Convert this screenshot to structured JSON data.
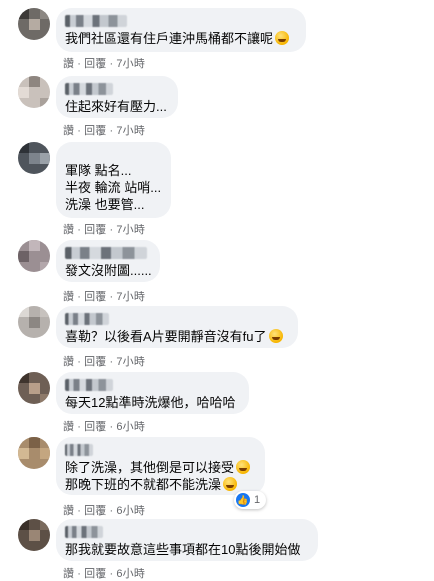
{
  "colors": {
    "bubble": "#f0f2f5",
    "meta": "#65676b",
    "like": "#1877f2"
  },
  "comments": [
    {
      "text": [
        "我們社區還有住戶連沖馬桶都不讓呢"
      ],
      "emoji": "laughing-face-icon",
      "meta": {
        "like": "讚",
        "reply": "回覆",
        "time": "7小時"
      }
    },
    {
      "name_partial": "亨 寶",
      "text": [
        "住起來好有壓力..."
      ],
      "meta": {
        "like": "讚",
        "reply": "回覆",
        "time": "7小時"
      }
    },
    {
      "text": [
        "軍隊 點名...",
        "半夜 輪流 站哨...",
        "洗澡 也要管..."
      ],
      "meta": {
        "like": "讚",
        "reply": "回覆",
        "time": "7小時"
      }
    },
    {
      "text": [
        "發文沒附圖......"
      ],
      "meta": {
        "like": "讚",
        "reply": "回覆",
        "time": "7小時"
      }
    },
    {
      "text": [
        "喜勒？以後看A片要開靜音沒有fu了"
      ],
      "emoji": "crying-laughing-face-icon",
      "meta": {
        "like": "讚",
        "reply": "回覆",
        "time": "7小時"
      }
    },
    {
      "text": [
        "每天12點準時洗爆他，哈哈哈"
      ],
      "meta": {
        "like": "讚",
        "reply": "回覆",
        "time": "6小時"
      }
    },
    {
      "text": [
        "除了洗澡，其他倒是可以接受",
        "那晚下班的不就都不能洗澡"
      ],
      "emoji": "grinning-face-icon",
      "meta": {
        "like": "讚",
        "reply": "回覆",
        "time": "6小時"
      },
      "reaction_count": "1"
    },
    {
      "text": [
        "那我就要故意這些事項都在10點後開始做"
      ],
      "meta": {
        "like": "讚",
        "reply": "回覆",
        "time": "6小時"
      }
    }
  ]
}
